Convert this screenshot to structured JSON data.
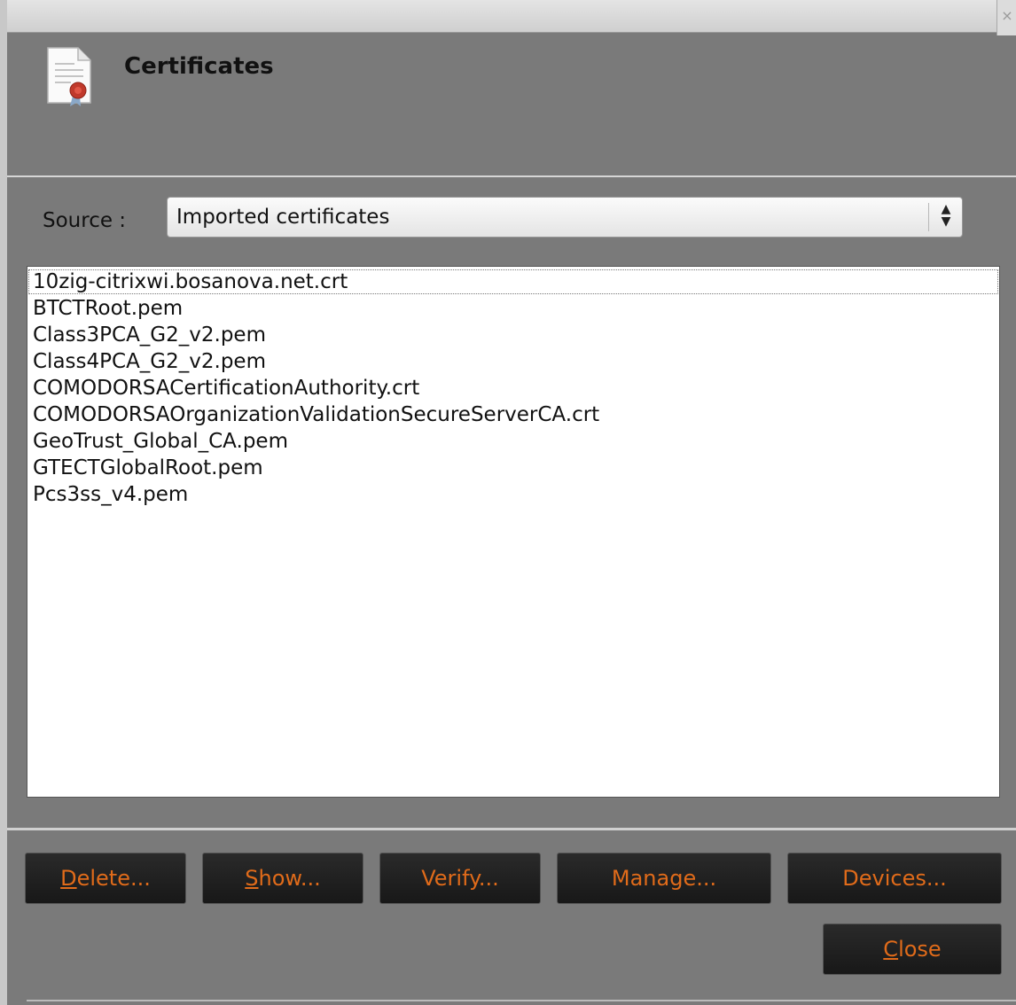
{
  "window": {
    "close_glyph": "×"
  },
  "header": {
    "title": "Certificates",
    "icon": "certificate-icon"
  },
  "source": {
    "label": "Source :",
    "selected": "Imported certificates"
  },
  "certificates": [
    "10zig-citrixwi.bosanova.net.crt",
    "BTCTRoot.pem",
    "Class3PCA_G2_v2.pem",
    "Class4PCA_G2_v2.pem",
    "COMODORSACertificationAuthority.crt",
    "COMODORSAOrganizationValidationSecureServerCA.crt",
    "GeoTrust_Global_CA.pem",
    "GTECTGlobalRoot.pem",
    "Pcs3ss_v4.pem"
  ],
  "buttons": {
    "delete": {
      "mnemonic": "D",
      "rest": "elete..."
    },
    "show": {
      "mnemonic": "S",
      "rest": "how..."
    },
    "verify": "Verify...",
    "manage": "Manage...",
    "devices": "Devices...",
    "close": {
      "mnemonic": "C",
      "rest": "lose"
    }
  },
  "colors": {
    "button_text": "#e06b1a",
    "button_bg": "#1e1e1e",
    "dialog_bg": "#7a7a7a"
  }
}
